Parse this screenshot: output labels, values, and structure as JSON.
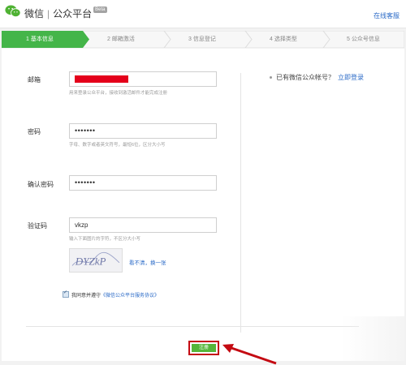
{
  "header": {
    "brand_name": "微信",
    "separator": "|",
    "platform": "公众平台",
    "beta_badge": "Beta",
    "help_link": "在线客服"
  },
  "steps": [
    {
      "label": "1 基本信息",
      "active": true
    },
    {
      "label": "2 邮箱激活",
      "active": false
    },
    {
      "label": "3 信息登记",
      "active": false
    },
    {
      "label": "4 选择类型",
      "active": false
    },
    {
      "label": "5 公众号信息",
      "active": false
    }
  ],
  "form": {
    "email": {
      "label": "邮箱",
      "hint": "用来登录公众平台，接收到激活邮件才能完成注册"
    },
    "password": {
      "label": "密码",
      "value": "•••••••",
      "hint": "字母、数字或者英文符号，最短6位，区分大小写"
    },
    "confirm": {
      "label": "确认密码",
      "value": "•••••••"
    },
    "captcha": {
      "label": "验证码",
      "value": "vkzp",
      "hint": "输入下面图片的字符，不区分大小写",
      "image_text": "DYZkP",
      "refresh_link": "看不清，换一张"
    },
    "agree": {
      "text": "我同意并遵守",
      "link": "《微信公众平台服务协议》",
      "checked": true
    }
  },
  "side": {
    "question": "已有微信公众帐号？",
    "login_link": "立即登录"
  },
  "submit": {
    "label": "注册"
  },
  "colors": {
    "active_step": "#44b549",
    "link": "#2a6ac7",
    "button": "#55b63a",
    "highlight": "#c40a12",
    "redaction": "#e4001b"
  }
}
